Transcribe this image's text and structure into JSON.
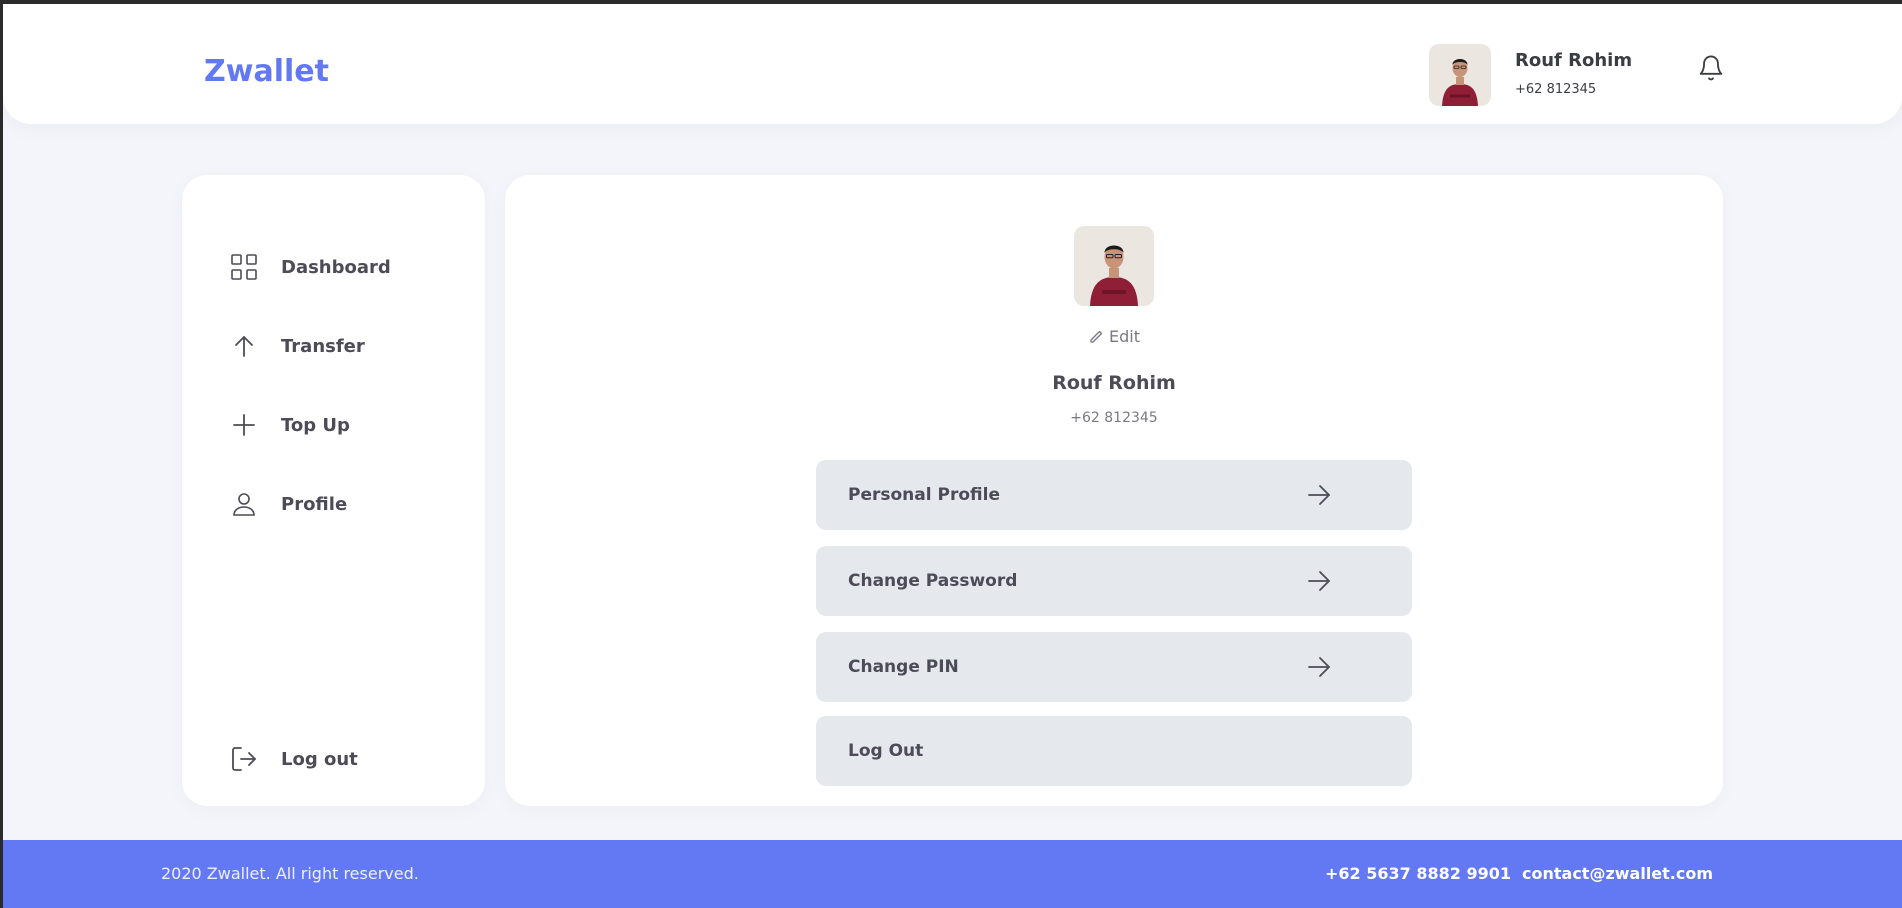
{
  "app": {
    "brand": "Zwallet",
    "accent_color": "#6379f4"
  },
  "header": {
    "user_name": "Rouf Rohim",
    "user_phone": "+62 812345",
    "avatar_icon": "user-avatar",
    "notification_icon": "bell-icon"
  },
  "sidebar": {
    "items": [
      {
        "label": "Dashboard",
        "icon": "grid-icon"
      },
      {
        "label": "Transfer",
        "icon": "arrow-up-icon"
      },
      {
        "label": "Top Up",
        "icon": "plus-icon"
      },
      {
        "label": "Profile",
        "icon": "user-icon"
      }
    ],
    "logout": {
      "label": "Log out",
      "icon": "logout-icon"
    }
  },
  "profile": {
    "edit_label": "Edit",
    "name": "Rouf Rohim",
    "phone": "+62 812345",
    "menu": [
      {
        "label": "Personal Profile",
        "icon": "arrow-right-icon"
      },
      {
        "label": "Change Password",
        "icon": "arrow-right-icon"
      },
      {
        "label": "Change PIN",
        "icon": "arrow-right-icon"
      },
      {
        "label": "Log Out"
      }
    ]
  },
  "footer": {
    "copyright": "2020 Zwallet. All right reserved.",
    "phone": "+62 5637 8882 9901",
    "email": "contact@zwallet.com"
  }
}
